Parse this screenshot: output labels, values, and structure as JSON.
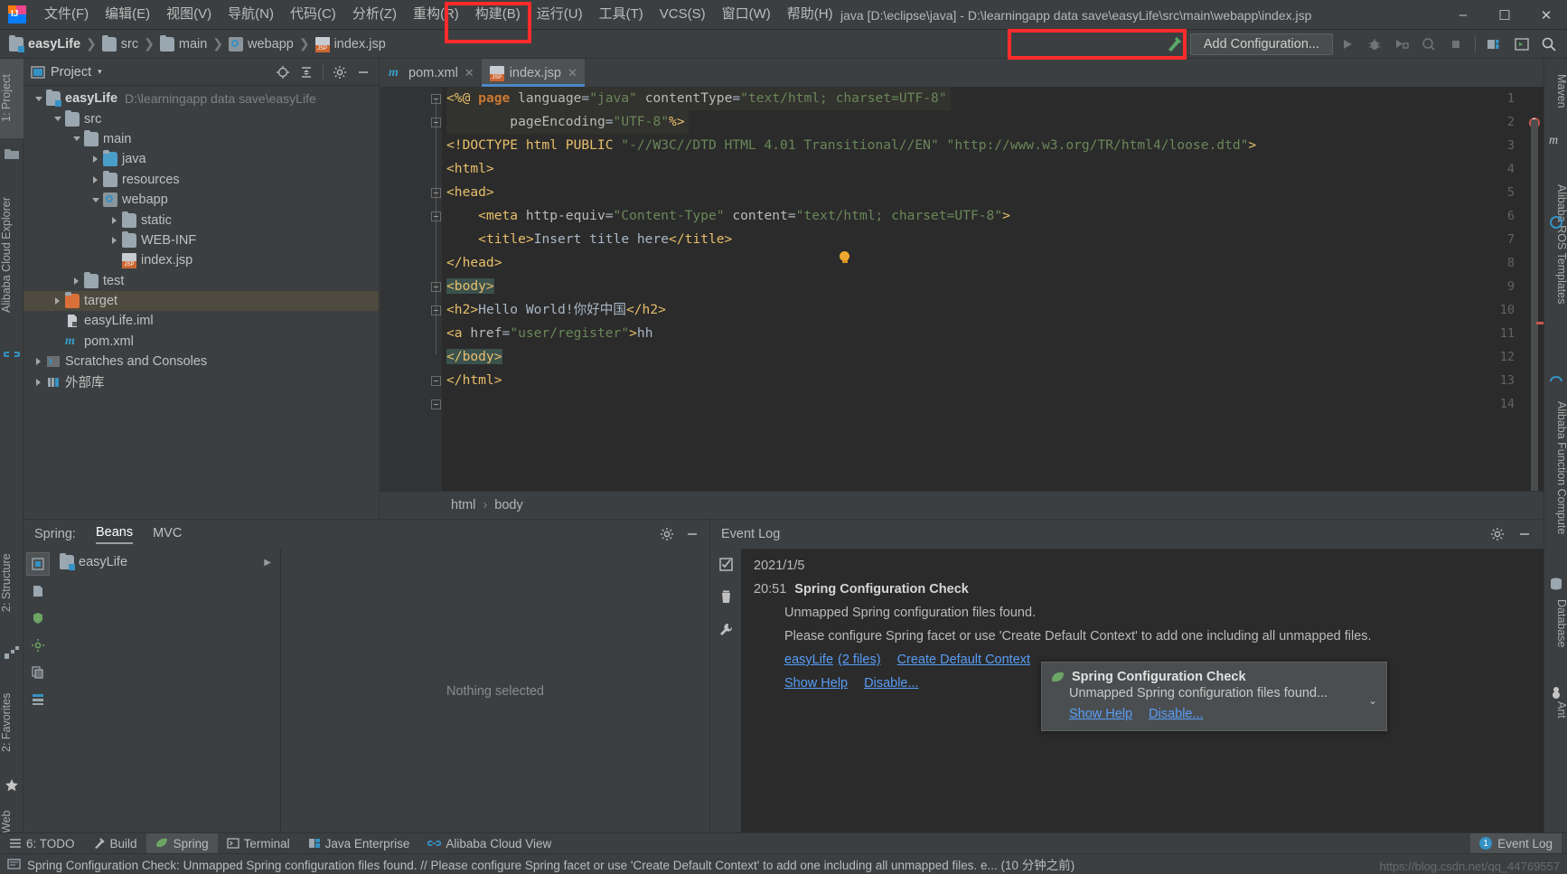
{
  "window": {
    "title": "java [D:\\eclipse\\java] - D:\\learningapp data save\\easyLife\\src\\main\\webapp\\index.jsp",
    "minimize": "–",
    "maximize": "☐",
    "close": "✕"
  },
  "menubar": {
    "items": [
      {
        "label": "文件(F)",
        "name": "menu-file"
      },
      {
        "label": "编辑(E)",
        "name": "menu-edit"
      },
      {
        "label": "视图(V)",
        "name": "menu-view"
      },
      {
        "label": "导航(N)",
        "name": "menu-navigate"
      },
      {
        "label": "代码(C)",
        "name": "menu-code"
      },
      {
        "label": "分析(Z)",
        "name": "menu-analyze"
      },
      {
        "label": "重构(R)",
        "name": "menu-refactor"
      },
      {
        "label": "构建(B)",
        "name": "menu-build"
      },
      {
        "label": "运行(U)",
        "name": "menu-run"
      },
      {
        "label": "工具(T)",
        "name": "menu-tools"
      },
      {
        "label": "VCS(S)",
        "name": "menu-vcs"
      },
      {
        "label": "窗口(W)",
        "name": "menu-window"
      },
      {
        "label": "帮助(H)",
        "name": "menu-help"
      }
    ]
  },
  "navbar": {
    "crumbs": [
      {
        "label": "easyLife",
        "icon": "module-folder-icon"
      },
      {
        "label": "src",
        "icon": "folder-icon"
      },
      {
        "label": "main",
        "icon": "folder-icon"
      },
      {
        "label": "webapp",
        "icon": "webapp-folder-icon"
      },
      {
        "label": "index.jsp",
        "icon": "jsp-file-icon"
      }
    ],
    "separator": "❯",
    "add_configuration": "Add Configuration...",
    "toolbar_icons": [
      "run-icon",
      "debug-icon",
      "run-with-coverage-icon",
      "profile-icon",
      "stop-icon",
      "project-structure-icon",
      "open-terminal-icon",
      "search-everywhere-icon"
    ]
  },
  "left_strip": {
    "tabs": [
      {
        "label": "1: Project",
        "name": "strip-tab-project",
        "selected": true
      },
      {
        "label": "Alibaba Cloud Explorer",
        "name": "strip-tab-alibaba-cloud-explorer",
        "selected": false
      },
      {
        "label": "2: Structure",
        "name": "strip-tab-structure",
        "selected": false
      },
      {
        "label": "2: Favorites",
        "name": "strip-tab-favorites",
        "selected": false
      },
      {
        "label": "Web",
        "name": "strip-tab-web",
        "selected": false
      }
    ]
  },
  "right_strip": {
    "tabs": [
      {
        "label": "Maven",
        "name": "strip-tab-maven"
      },
      {
        "label": "Alibaba ROS Templates",
        "name": "strip-tab-alibaba-ros-templates"
      },
      {
        "label": "Alibaba Function Compute",
        "name": "strip-tab-alibaba-function-compute"
      },
      {
        "label": "Database",
        "name": "strip-tab-database"
      },
      {
        "label": "Ant",
        "name": "strip-tab-ant"
      }
    ]
  },
  "project_panel": {
    "title": "Project",
    "dropdown_glyph": "▾",
    "header_icons": [
      "locate-icon",
      "collapse-all-icon",
      "settings-gear-icon",
      "hide-icon"
    ],
    "tree": [
      {
        "depth": 0,
        "arrow": "down",
        "icon": "module-folder-icon",
        "label": "easyLife",
        "bold": true,
        "path": "D:\\learningapp data save\\easyLife",
        "selected": false
      },
      {
        "depth": 1,
        "arrow": "down",
        "icon": "folder-icon",
        "label": "src",
        "bold": false,
        "path": "",
        "selected": false
      },
      {
        "depth": 2,
        "arrow": "down",
        "icon": "folder-icon",
        "label": "main",
        "bold": false,
        "path": "",
        "selected": false
      },
      {
        "depth": 3,
        "arrow": "right",
        "icon": "source-folder-icon",
        "label": "java",
        "bold": false,
        "path": "",
        "selected": false
      },
      {
        "depth": 3,
        "arrow": "right",
        "icon": "folder-icon",
        "label": "resources",
        "bold": false,
        "path": "",
        "selected": false
      },
      {
        "depth": 3,
        "arrow": "down",
        "icon": "webapp-folder-icon",
        "label": "webapp",
        "bold": false,
        "path": "",
        "selected": false
      },
      {
        "depth": 4,
        "arrow": "right",
        "icon": "folder-icon",
        "label": "static",
        "bold": false,
        "path": "",
        "selected": false
      },
      {
        "depth": 4,
        "arrow": "right",
        "icon": "folder-icon",
        "label": "WEB-INF",
        "bold": false,
        "path": "",
        "selected": false
      },
      {
        "depth": 4,
        "arrow": "none",
        "icon": "jsp-file-icon",
        "label": "index.jsp",
        "bold": false,
        "path": "",
        "selected": false
      },
      {
        "depth": 2,
        "arrow": "right",
        "icon": "folder-icon",
        "label": "test",
        "bold": false,
        "path": "",
        "selected": false
      },
      {
        "depth": 1,
        "arrow": "right",
        "icon": "excluded-folder-icon",
        "label": "target",
        "bold": false,
        "path": "",
        "selected": true
      },
      {
        "depth": 1,
        "arrow": "none",
        "icon": "iml-file-icon",
        "label": "easyLife.iml",
        "bold": false,
        "path": "",
        "selected": false
      },
      {
        "depth": 1,
        "arrow": "none",
        "icon": "maven-file-icon",
        "label": "pom.xml",
        "bold": false,
        "path": "",
        "selected": false
      },
      {
        "depth": 0,
        "arrow": "right",
        "icon": "scratches-icon",
        "label": "Scratches and Consoles",
        "bold": false,
        "path": "",
        "selected": false
      },
      {
        "depth": 0,
        "arrow": "right",
        "icon": "external-libraries-icon",
        "label": "外部库",
        "bold": false,
        "path": "",
        "selected": false
      }
    ]
  },
  "editor": {
    "tabs": [
      {
        "label": "pom.xml",
        "icon": "maven-file-icon",
        "active": false,
        "close": "✕"
      },
      {
        "label": "index.jsp",
        "icon": "jsp-file-icon",
        "active": true,
        "close": "✕"
      }
    ],
    "line_numbers": [
      "1",
      "2",
      "3",
      "4",
      "5",
      "6",
      "7",
      "8",
      "9",
      "10",
      "11",
      "12",
      "13",
      "14"
    ],
    "code_lines": [
      "<%@ page language=\"java\" contentType=\"text/html; charset=UTF-8\"",
      "        pageEncoding=\"UTF-8\"%>",
      "<!DOCTYPE html PUBLIC \"-//W3C//DTD HTML 4.01 Transitional//EN\" \"http://www.w3.org/TR/html4/loose.dtd\">",
      "<html>",
      "<head>",
      "    <meta http-equiv=\"Content-Type\" content=\"text/html; charset=UTF-8\">",
      "    <title>Insert title here</title>",
      "</head>",
      "<body>",
      "<h2>Hello World!你好中国</h2>",
      "<a href=\"user/register\">hh",
      "</body>",
      "</html>",
      ""
    ],
    "breadcrumb": [
      "html",
      "body"
    ],
    "breadcrumb_sep": "›",
    "error_count": "1"
  },
  "spring_panel": {
    "label": "Spring:",
    "tabs": [
      {
        "label": "Beans",
        "selected": true
      },
      {
        "label": "MVC",
        "selected": false
      }
    ],
    "list": [
      {
        "label": "easyLife",
        "expand_glyph": "▶"
      }
    ],
    "detail_placeholder": "Nothing selected",
    "header_icons": [
      "settings-gear-icon",
      "hide-icon"
    ]
  },
  "event_log": {
    "title": "Event Log",
    "header_icons": [
      "settings-gear-icon",
      "hide-icon"
    ],
    "toolbar_icons": [
      "mark-all-read-icon",
      "clear-all-icon",
      "settings-wrench-icon"
    ],
    "entries": [
      {
        "date": "2021/1/5"
      },
      {
        "time": "20:51",
        "title": "Spring Configuration Check"
      },
      {
        "message": "Unmapped Spring configuration files found."
      },
      {
        "message": "Please configure Spring facet or use 'Create Default Context' to add one including all unmapped files."
      }
    ],
    "links_row1": [
      {
        "label": "easyLife",
        "name": "event-log-link-easylife"
      },
      {
        "label": "(2 files)",
        "name": "event-log-link-2-files"
      },
      {
        "label": "Create Default Context",
        "name": "event-log-link-create-default-context"
      }
    ],
    "links_row2": [
      {
        "label": "Show Help",
        "name": "event-log-link-show-help"
      },
      {
        "label": "Disable...",
        "name": "event-log-link-disable"
      }
    ]
  },
  "balloon": {
    "title": "Spring Configuration Check",
    "message": "Unmapped Spring configuration files found...",
    "actions": [
      {
        "label": "Show Help",
        "name": "balloon-show-help-link"
      },
      {
        "label": "Disable...",
        "name": "balloon-disable-link"
      }
    ],
    "chevron": "⌄",
    "icon": "spring-leaf-icon"
  },
  "bottom_tabs": [
    {
      "label": "6: TODO",
      "icon": "todo-icon",
      "selected": false,
      "name": "bottom-tab-todo"
    },
    {
      "label": "Build",
      "icon": "build-hammer-icon",
      "selected": false,
      "name": "bottom-tab-build"
    },
    {
      "label": "Spring",
      "icon": "spring-leaf-icon",
      "selected": true,
      "name": "bottom-tab-spring"
    },
    {
      "label": "Terminal",
      "icon": "terminal-icon",
      "selected": false,
      "name": "bottom-tab-terminal"
    },
    {
      "label": "Java Enterprise",
      "icon": "java-enterprise-icon",
      "selected": false,
      "name": "bottom-tab-java-enterprise"
    },
    {
      "label": "Alibaba Cloud View",
      "icon": "alibaba-cloud-icon",
      "selected": false,
      "name": "bottom-tab-alibaba-cloud-view"
    }
  ],
  "event_log_badge": {
    "count": "1",
    "label": "Event Log"
  },
  "status_bar": {
    "message": "Spring Configuration Check: Unmapped Spring configuration files found. // Please configure Spring facet or use 'Create Default Context' to add one including all unmapped files. e... (10 分钟之前)",
    "watermark": "https://blog.csdn.net/qq_44769557"
  },
  "colors": {
    "accent_blue": "#3592c4",
    "tab_underline": "#4a88c7",
    "selection_olive": "#4e4a3f",
    "editor_bg": "#2b2b2b",
    "panel_bg": "#3c3f41",
    "annotation_red": "#ff2b2b",
    "link_blue": "#589df6",
    "error_red": "#c75450",
    "spring_green": "#6ca564"
  }
}
